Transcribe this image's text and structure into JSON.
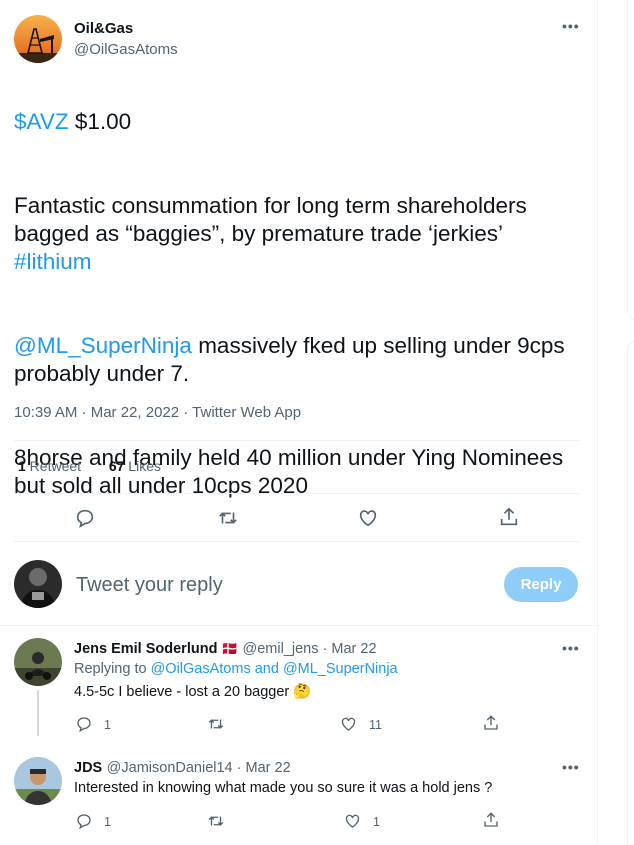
{
  "tweet": {
    "display_name": "Oil&Gas",
    "handle": "@OilGasAtoms",
    "cashtag": "$AVZ",
    "price": " $1.00",
    "para1": "Fantastic consummation for long term shareholders bagged as “baggies”, by premature trade ‘jerkies’",
    "hashtag": "#lithium",
    "mention": "@ML_SuperNinja",
    "para2_rest": " massively fked up selling under 9cps probably under 7.",
    "para3": "8horse and family held 40 million under Ying Nominees but sold all under 10cps 2020",
    "timestamp": "10:39 AM · Mar 22, 2022",
    "source_sep": " · ",
    "source": "Twitter Web App",
    "retweet_count": "1",
    "retweet_label": " Retweet",
    "like_count": "67",
    "like_label": " Likes"
  },
  "compose": {
    "placeholder": "Tweet your reply",
    "button": "Reply"
  },
  "replies": [
    {
      "name": "Jens Emil Soderlund",
      "flag": "🇩🇰",
      "handle": "@emil_jens",
      "sep": " · ",
      "date": "Mar 22",
      "replying_to_label": "Replying to ",
      "replying_to": "@OilGasAtoms and @ML_SuperNinja",
      "text": "4.5-5c I believe - lost a 20 bagger ",
      "emoji": "🤔",
      "reply_count": "1",
      "like_count": "11"
    },
    {
      "name": "JDS",
      "handle": "@JamisonDaniel14",
      "sep": " · ",
      "date": "Mar 22",
      "text": "Interested in knowing what made you so sure it was a hold jens ?",
      "reply_count": "1",
      "like_count": "1"
    }
  ],
  "icons": [
    "more-icon",
    "reply-icon",
    "retweet-icon",
    "like-icon",
    "share-icon"
  ],
  "colors": {
    "accent": "#1d9bf0",
    "muted": "#536471",
    "reply_button": "#8ecdf8"
  }
}
